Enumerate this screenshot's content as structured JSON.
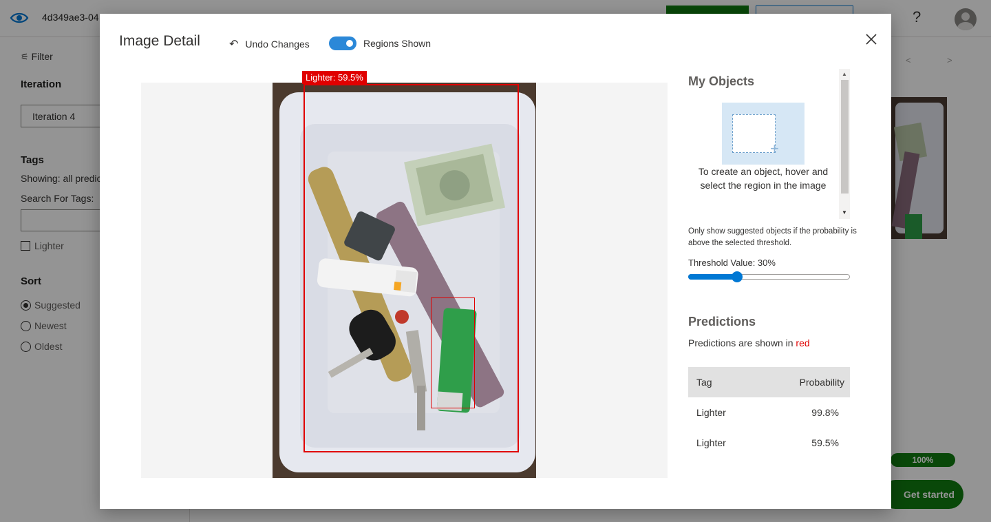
{
  "app": {
    "project_id": "4d349ae3-04"
  },
  "sidebar": {
    "filter_label": "Filter",
    "iteration_heading": "Iteration",
    "iteration_value": "Iteration 4",
    "tags_heading": "Tags",
    "showing_text": "Showing: all predic",
    "search_label": "Search For Tags:",
    "tag_items": [
      {
        "label": "Lighter",
        "checked": false
      }
    ],
    "sort_heading": "Sort",
    "sort_options": [
      {
        "label": "Suggested",
        "selected": true
      },
      {
        "label": "Newest",
        "selected": false
      },
      {
        "label": "Oldest",
        "selected": false
      }
    ]
  },
  "background": {
    "nav_prev": "<",
    "nav_next": ">",
    "progress_text": "100%",
    "get_started_label": "Get started"
  },
  "modal": {
    "title": "Image Detail",
    "undo_label": "Undo Changes",
    "regions_toggle": {
      "label": "Regions Shown",
      "on": true
    },
    "region_label": "Lighter: 59.5%",
    "my_objects": {
      "title": "My Objects",
      "hint": "To create an object, hover and select the region in the image"
    },
    "threshold": {
      "note": "Only show suggested objects if the probability is above the selected threshold.",
      "label": "Threshold Value: 30%",
      "value": 0.3
    },
    "predictions": {
      "title": "Predictions",
      "subtitle_prefix": "Predictions are shown in",
      "subtitle_color_word": "red",
      "columns": [
        "Tag",
        "Probability"
      ],
      "rows": [
        {
          "tag": "Lighter",
          "probability": "99.8%"
        },
        {
          "tag": "Lighter",
          "probability": "59.5%"
        }
      ]
    }
  },
  "colors": {
    "prediction_red": "#e00000",
    "accent_blue": "#0078d4",
    "brand_green": "#107c10"
  }
}
